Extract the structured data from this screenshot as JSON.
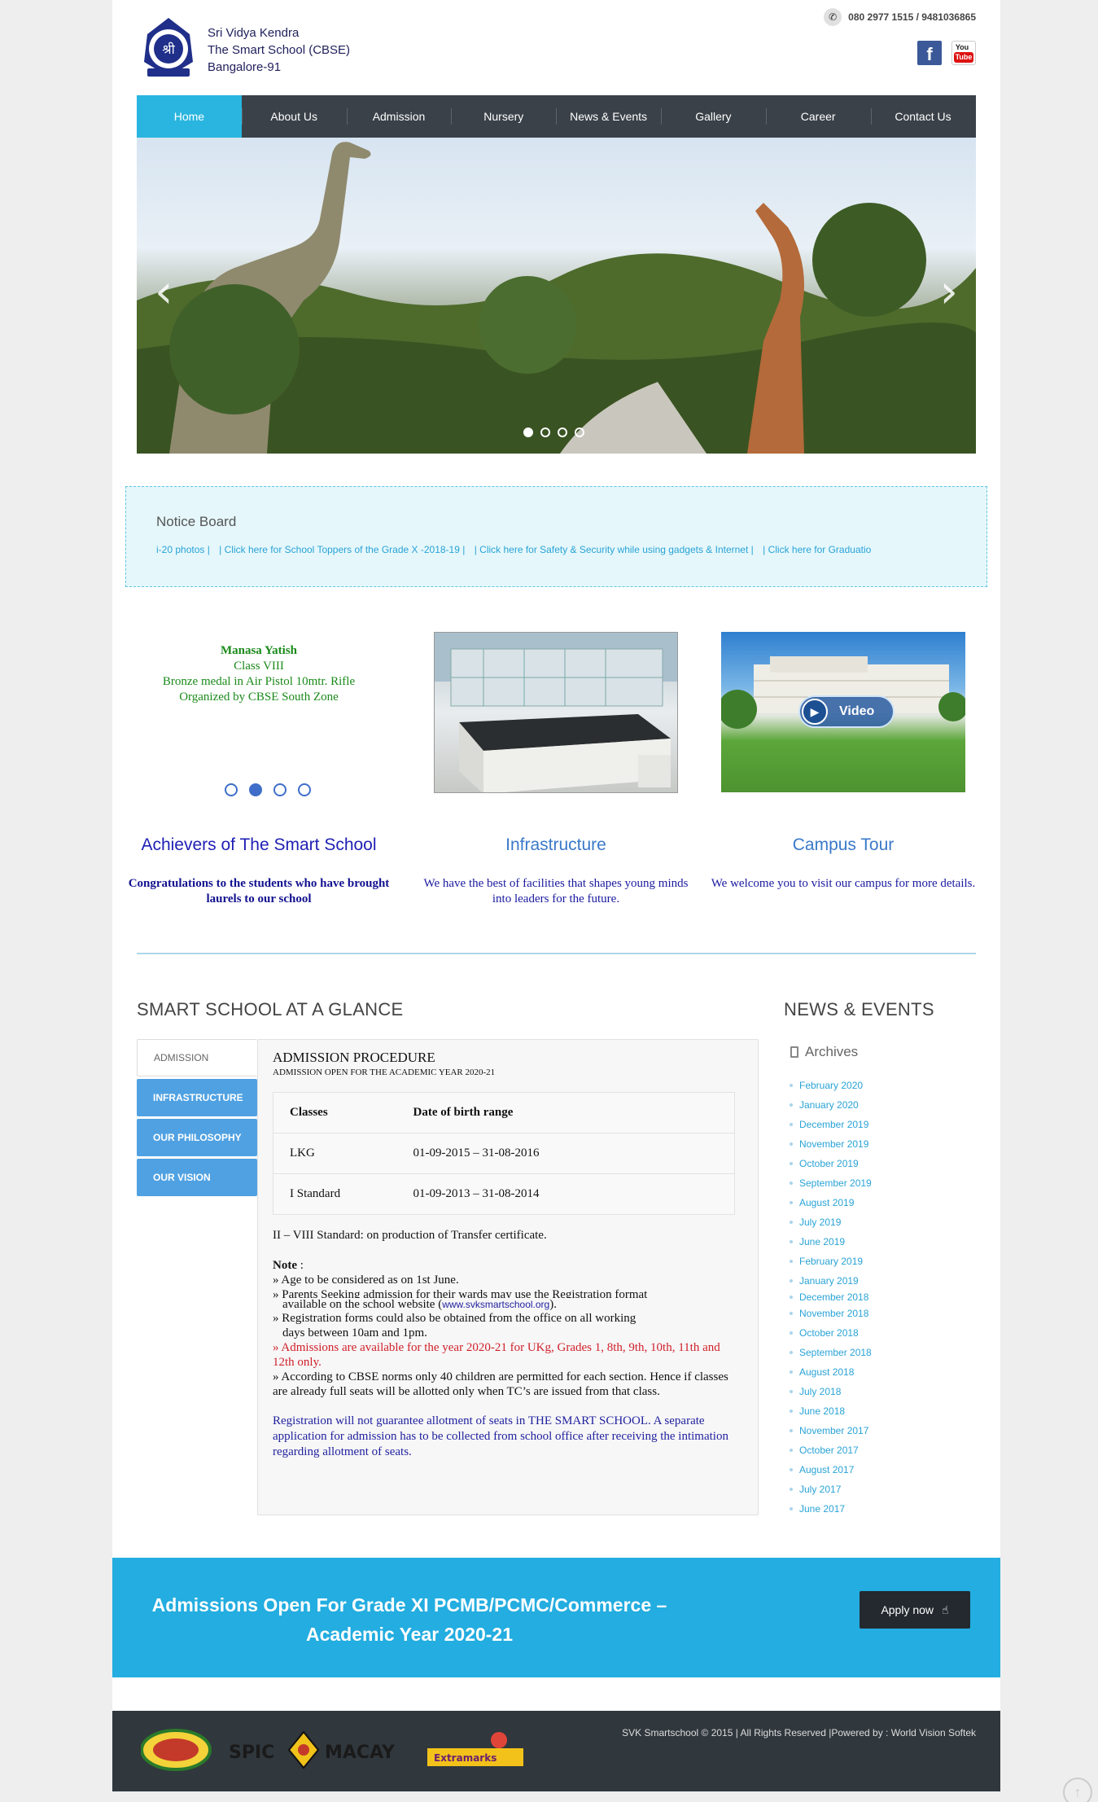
{
  "header": {
    "school_line1": "Sri Vidya Kendra",
    "school_line2": "The Smart School (CBSE)",
    "school_line3": "Bangalore-91",
    "phone": "080 2977 1515 / 9481036865",
    "social_icons": [
      "facebook-icon",
      "youtube-icon"
    ],
    "youtube_top": "You",
    "youtube_bottom": "Tube"
  },
  "nav": {
    "items": [
      "Home",
      "About Us",
      "Admission",
      "Nursery",
      "News & Events",
      "Gallery",
      "Career",
      "Contact Us"
    ],
    "active": "Home"
  },
  "slider": {
    "prev": "‹",
    "next": "›",
    "slide_count": 4,
    "active_slide": 1
  },
  "notice": {
    "title": "Notice Board",
    "items": [
      "i-20 photos |",
      "| Click here for School Toppers of the Grade X -2018-19 |",
      "| Click here for Safety & Security while using gadgets & Internet |",
      "| Click here for Graduatio"
    ]
  },
  "achiever": {
    "name": "Manasa Yatish",
    "class": "Class VIII",
    "award": "Bronze medal in Air Pistol 10mtr. Rifle",
    "organizer": "Organized by CBSE South Zone",
    "slide_count": 4,
    "active_slide": 2
  },
  "blocks": [
    {
      "title": "Achievers of The Smart School",
      "text": "Congratulations to the students who have brought laurels to our school"
    },
    {
      "title": "Infrastructure",
      "text": "We have the best of facilities that shapes young minds into leaders for the future."
    },
    {
      "title": "Campus Tour",
      "text": "We welcome you to visit our campus for more details."
    }
  ],
  "video_label": "Video",
  "glance": {
    "heading": "SMART SCHOOL AT A GLANCE",
    "tabs": [
      "ADMISSION",
      "INFRASTRUCTURE",
      "OUR PHILOSOPHY",
      "OUR VISION"
    ],
    "active_tab": "ADMISSION",
    "proc_title": "ADMISSION PROCEDURE",
    "proc_sub": "ADMISSION OPEN FOR THE  ACADEMIC YEAR 2020-21",
    "table": {
      "headers": [
        "Classes",
        "Date of birth range"
      ],
      "rows": [
        [
          "LKG",
          "01-09-2015 – 31-08-2016"
        ],
        [
          "I Standard",
          "01-09-2013 – 31-08-2014"
        ]
      ]
    },
    "transfer": "II – VIII Standard: on production of Transfer certificate.",
    "note_label": "Note",
    "note_colon": " :",
    "notes": {
      "n1": "» Age to be considered as on 1st June.",
      "n2a": "» Parents Seeking admission for their wards may use the Registration format",
      "n2b": "available on the school website (",
      "n2_link": "www.svksmartschool.org",
      "n2c": ").",
      "n3a": "» Registration forms could also be obtained from the office on all working",
      "n3b": "days between 10am and 1pm.",
      "n4": "» Admissions are available for the year 2020-21 for UKg, Grades 1, 8th, 9th, 10th, 11th and 12th only.",
      "n5": "» According to CBSE norms only 40 children are permitted for each section. Hence if classes are already full seats will be allotted only when TC’s are issued from that class."
    },
    "registration": "Registration will not guarantee allotment of seats in THE SMART SCHOOL. A separate application for admission has to be collected from school office after receiving the intimation regarding allotment of seats."
  },
  "news": {
    "heading": "NEWS & EVENTS",
    "archives_label": "Archives",
    "archives": [
      "February 2020",
      "January 2020",
      "December 2019",
      "November 2019",
      "October 2019",
      "September 2019",
      "August 2019",
      "July 2019",
      "June 2019",
      "February 2019",
      "January 2019",
      "December 2018",
      "November 2018",
      "October 2018",
      "September 2018",
      "August 2018",
      "July 2018",
      "June 2018",
      "November 2017",
      "October 2017",
      "August 2017",
      "July 2017",
      "June 2017"
    ]
  },
  "banner": {
    "text": "Admissions Open For Grade XI PCMB/PCMC/Commerce – Academic Year 2020-21",
    "button": "Apply now"
  },
  "footer": {
    "copyright": "SVK Smartschool © 2015 | All Rights Reserved |Powered by : ",
    "powered_by": "World Vision Softek",
    "logo_spic": "SPIC",
    "logo_macay": "MACAY",
    "logo_extramarks": "Extramarks"
  },
  "colors": {
    "accent": "#29b5df",
    "nav_bg": "#3a4148",
    "tab_blue": "#4fa1e2",
    "banner": "#23ade0",
    "footer": "#30373d"
  }
}
